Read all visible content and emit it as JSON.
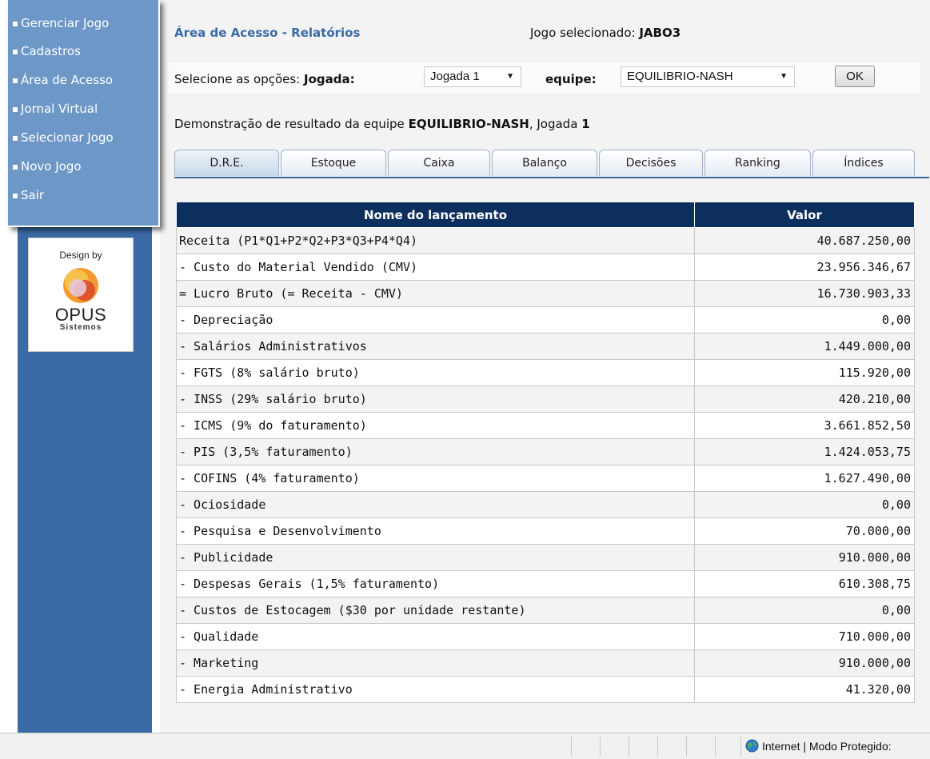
{
  "sidebar": {
    "menu": [
      "Gerenciar Jogo",
      "Cadastros",
      "Área de Acesso",
      "Jornal Virtual",
      "Selecionar Jogo",
      "Novo Jogo",
      "Sair"
    ],
    "logo": {
      "design_by": "Design by",
      "name": "OPUS",
      "sub": "Sistemos"
    }
  },
  "header": {
    "title": "Área de Acesso - Relatórios",
    "selected_game_label": "Jogo selecionado:",
    "selected_game_value": "JABO3"
  },
  "options": {
    "label_prefix": "Selecione as opções:",
    "jogada_label": "Jogada:",
    "jogada_value": "Jogada 1",
    "equipe_label": "equipe:",
    "equipe_value": "EQUILIBRIO-NASH",
    "ok_label": "OK"
  },
  "result_line": {
    "prefix": "Demonstração de resultado da equipe",
    "team": "EQUILIBRIO-NASH",
    "mid": ", Jogada",
    "jogada": "1"
  },
  "tabs": [
    "D.R.E.",
    "Estoque",
    "Caixa",
    "Balanço",
    "Decisões",
    "Ranking",
    "Índices"
  ],
  "active_tab": "D.R.E.",
  "table": {
    "headers": [
      "Nome do lançamento",
      "Valor"
    ],
    "rows": [
      [
        "Receita (P1*Q1+P2*Q2+P3*Q3+P4*Q4)",
        "40.687.250,00"
      ],
      [
        "- Custo do Material Vendido (CMV)",
        "23.956.346,67"
      ],
      [
        "= Lucro Bruto (= Receita - CMV)",
        "16.730.903,33"
      ],
      [
        "- Depreciação",
        "0,00"
      ],
      [
        "- Salários Administrativos",
        "1.449.000,00"
      ],
      [
        "- FGTS (8% salário bruto)",
        "115.920,00"
      ],
      [
        "- INSS (29% salário bruto)",
        "420.210,00"
      ],
      [
        "- ICMS (9% do faturamento)",
        "3.661.852,50"
      ],
      [
        "- PIS (3,5% faturamento)",
        "1.424.053,75"
      ],
      [
        "- COFINS (4% faturamento)",
        "1.627.490,00"
      ],
      [
        "- Ociosidade",
        "0,00"
      ],
      [
        "- Pesquisa e Desenvolvimento",
        "70.000,00"
      ],
      [
        "- Publicidade",
        "910.000,00"
      ],
      [
        "- Despesas Gerais (1,5% faturamento)",
        "610.308,75"
      ],
      [
        "- Custos de Estocagem ($30 por unidade restante)",
        "0,00"
      ],
      [
        "- Qualidade",
        "710.000,00"
      ],
      [
        "- Marketing",
        "910.000,00"
      ],
      [
        "- Energia Administrativo",
        "41.320,00"
      ]
    ]
  },
  "status_bar": {
    "zone_text": "Internet | Modo Protegido:"
  },
  "colors": {
    "sidebar_dark": "#3a6ba7",
    "menu_panel": "#6d97c7",
    "table_header": "#0d2f5e",
    "title_blue": "#3a6ba7"
  }
}
